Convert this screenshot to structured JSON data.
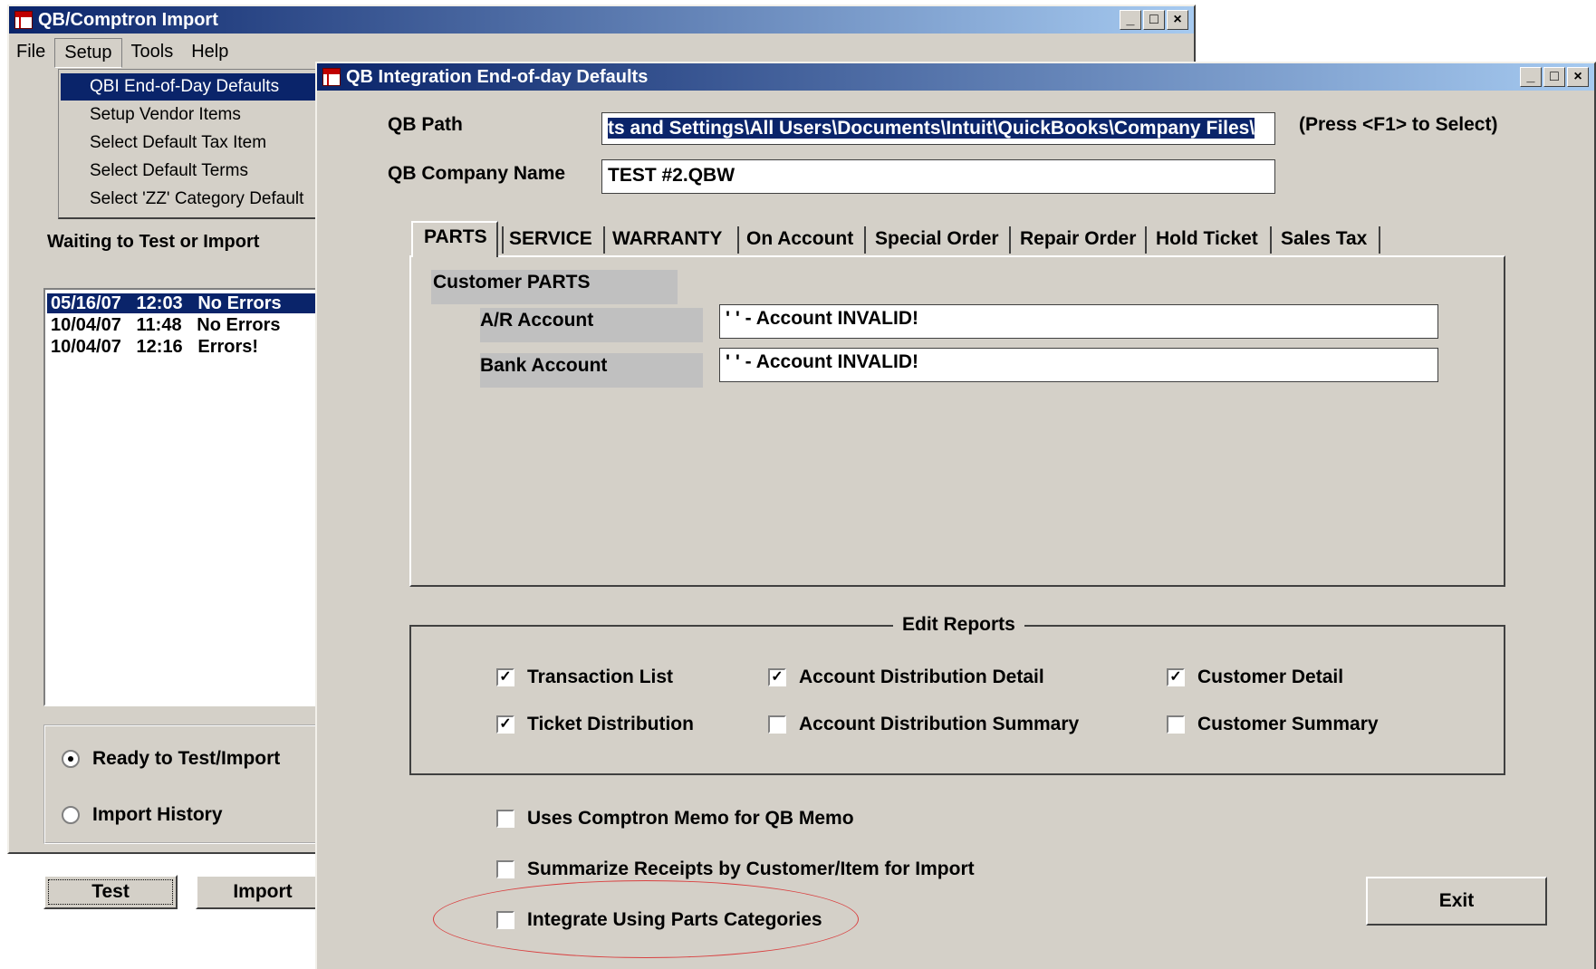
{
  "main_window": {
    "title": "QB/Comptron Import",
    "menu": [
      "File",
      "Setup",
      "Tools",
      "Help"
    ],
    "setup_menu_items": [
      "QBI End-of-Day Defaults",
      "Setup Vendor Items",
      "Select Default Tax Item",
      "Select Default Terms",
      "Select 'ZZ' Category Default"
    ],
    "status_label": "Waiting to Test or Import",
    "history_rows": [
      {
        "date": "05/16/07",
        "time": "12:03",
        "status": "No Errors"
      },
      {
        "date": "10/04/07",
        "time": "11:48",
        "status": "No Errors"
      },
      {
        "date": "10/04/07",
        "time": "12:16",
        "status": "Errors!"
      }
    ],
    "radio_ready": "Ready to Test/Import",
    "radio_history": "Import History",
    "test_button": "Test",
    "import_button": "Import"
  },
  "dialog": {
    "title": "QB Integration End-of-day Defaults",
    "qb_path_label": "QB Path",
    "qb_path_value": "ts and Settings\\All Users\\Documents\\Intuit\\QuickBooks\\Company Files\\",
    "qb_path_hint": "(Press <F1> to Select)",
    "company_label": "QB Company Name",
    "company_value": "TEST #2.QBW",
    "tabs": [
      "PARTS",
      "SERVICE",
      "WARRANTY",
      "On Account",
      "Special Order",
      "Repair Order",
      "Hold Ticket",
      "Sales Tax"
    ],
    "section_title": "Customer PARTS",
    "ar_label": "A/R Account",
    "ar_value": "'        ' - Account INVALID!",
    "bank_label": "Bank Account",
    "bank_value": "'        ' - Account INVALID!",
    "edit_reports_title": "Edit Reports",
    "reports": [
      {
        "label": "Transaction List",
        "checked": true
      },
      {
        "label": "Account Distribution Detail",
        "checked": true
      },
      {
        "label": "Customer Detail",
        "checked": true
      },
      {
        "label": "Ticket Distribution",
        "checked": true
      },
      {
        "label": "Account Distribution Summary",
        "checked": false
      },
      {
        "label": "Customer Summary",
        "checked": false
      }
    ],
    "opt_memo": "Uses Comptron Memo for QB Memo",
    "opt_summarize": "Summarize Receipts by Customer/Item for Import",
    "opt_categories": "Integrate Using Parts Categories",
    "exit_button": "Exit"
  },
  "colors": {
    "title_start": "#0a246a",
    "title_end": "#a6caf0",
    "face": "#d4d0c8",
    "annotation": "#d94040"
  }
}
